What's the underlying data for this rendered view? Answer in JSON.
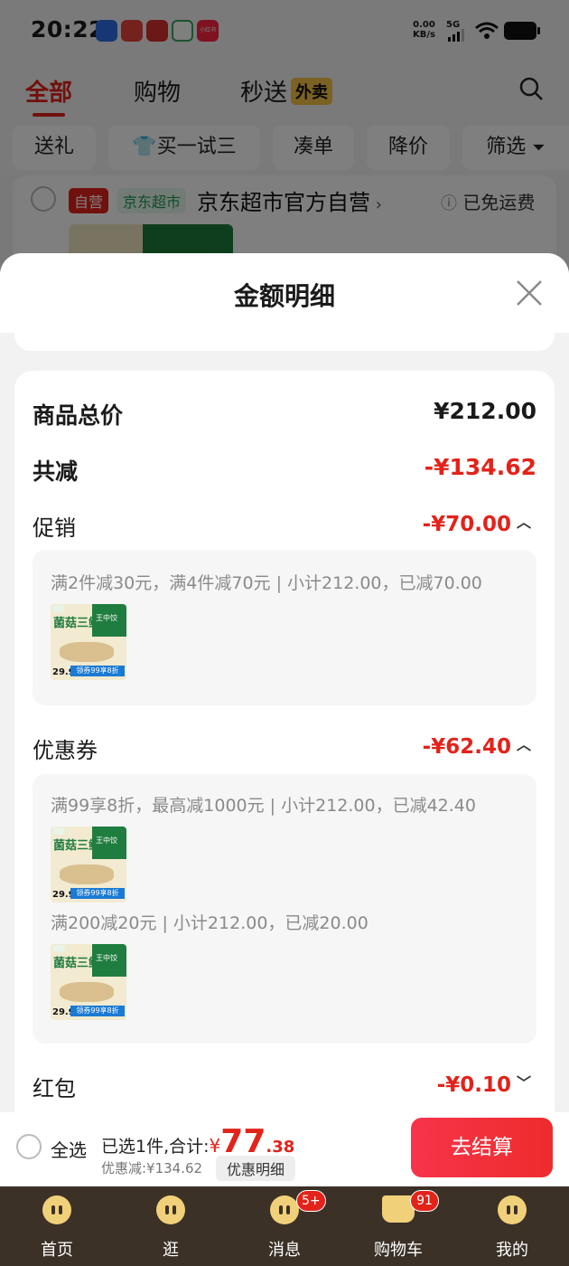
{
  "status_bar": {
    "time": "20:22",
    "speed_value": "0.00",
    "speed_unit": "KB/s",
    "network": "5G",
    "notification_badge": "小红书"
  },
  "top_tabs": [
    {
      "label": "全部",
      "active": true
    },
    {
      "label": "购物",
      "active": false
    },
    {
      "label": "秒送",
      "active": false,
      "badge": "外卖"
    }
  ],
  "filters": [
    "送礼",
    "买一试三",
    "凑单",
    "降价",
    "筛选"
  ],
  "store": {
    "tag_self": "自营",
    "tag_channel": "京东超市",
    "name": "京东超市官方自营",
    "shipping": "已免运费"
  },
  "sheet": {
    "title": "金额明细",
    "total_label": "商品总价",
    "total_value": "¥212.00",
    "reduce_label": "共减",
    "reduce_value": "-¥134.62",
    "promo": {
      "label": "促销",
      "value": "-¥70.00",
      "rule": "满2件减30元，满4件减70元 | 小计212.00，已减70.00"
    },
    "coupon": {
      "label": "优惠券",
      "value": "-¥62.40",
      "rules": [
        "满99享8折，最高减1000元 | 小计212.00，已减42.40",
        "满200减20元 | 小计212.00，已减20.00"
      ]
    },
    "redpacket": {
      "label": "红包",
      "value": "-¥0.10"
    }
  },
  "product_thumb": {
    "title": "菌菇三鲜",
    "brand_text": "王中饺",
    "price": "29.9",
    "band": "领券99享8折"
  },
  "bottom": {
    "select_all": "全选",
    "selected_text": "已选1件,合计:",
    "yen": "¥",
    "total_int": "77",
    "total_dec": ".38",
    "discount_text": "优惠减:¥134.62",
    "detail_button": "优惠明细",
    "checkout": "去结算"
  },
  "tabbar": [
    {
      "label": "首页"
    },
    {
      "label": "逛"
    },
    {
      "label": "消息",
      "badge": "5+"
    },
    {
      "label": "购物车",
      "badge": "91"
    },
    {
      "label": "我的"
    }
  ],
  "colors": {
    "accent": "#e2231a",
    "tabbar_bg": "#3b3126"
  }
}
